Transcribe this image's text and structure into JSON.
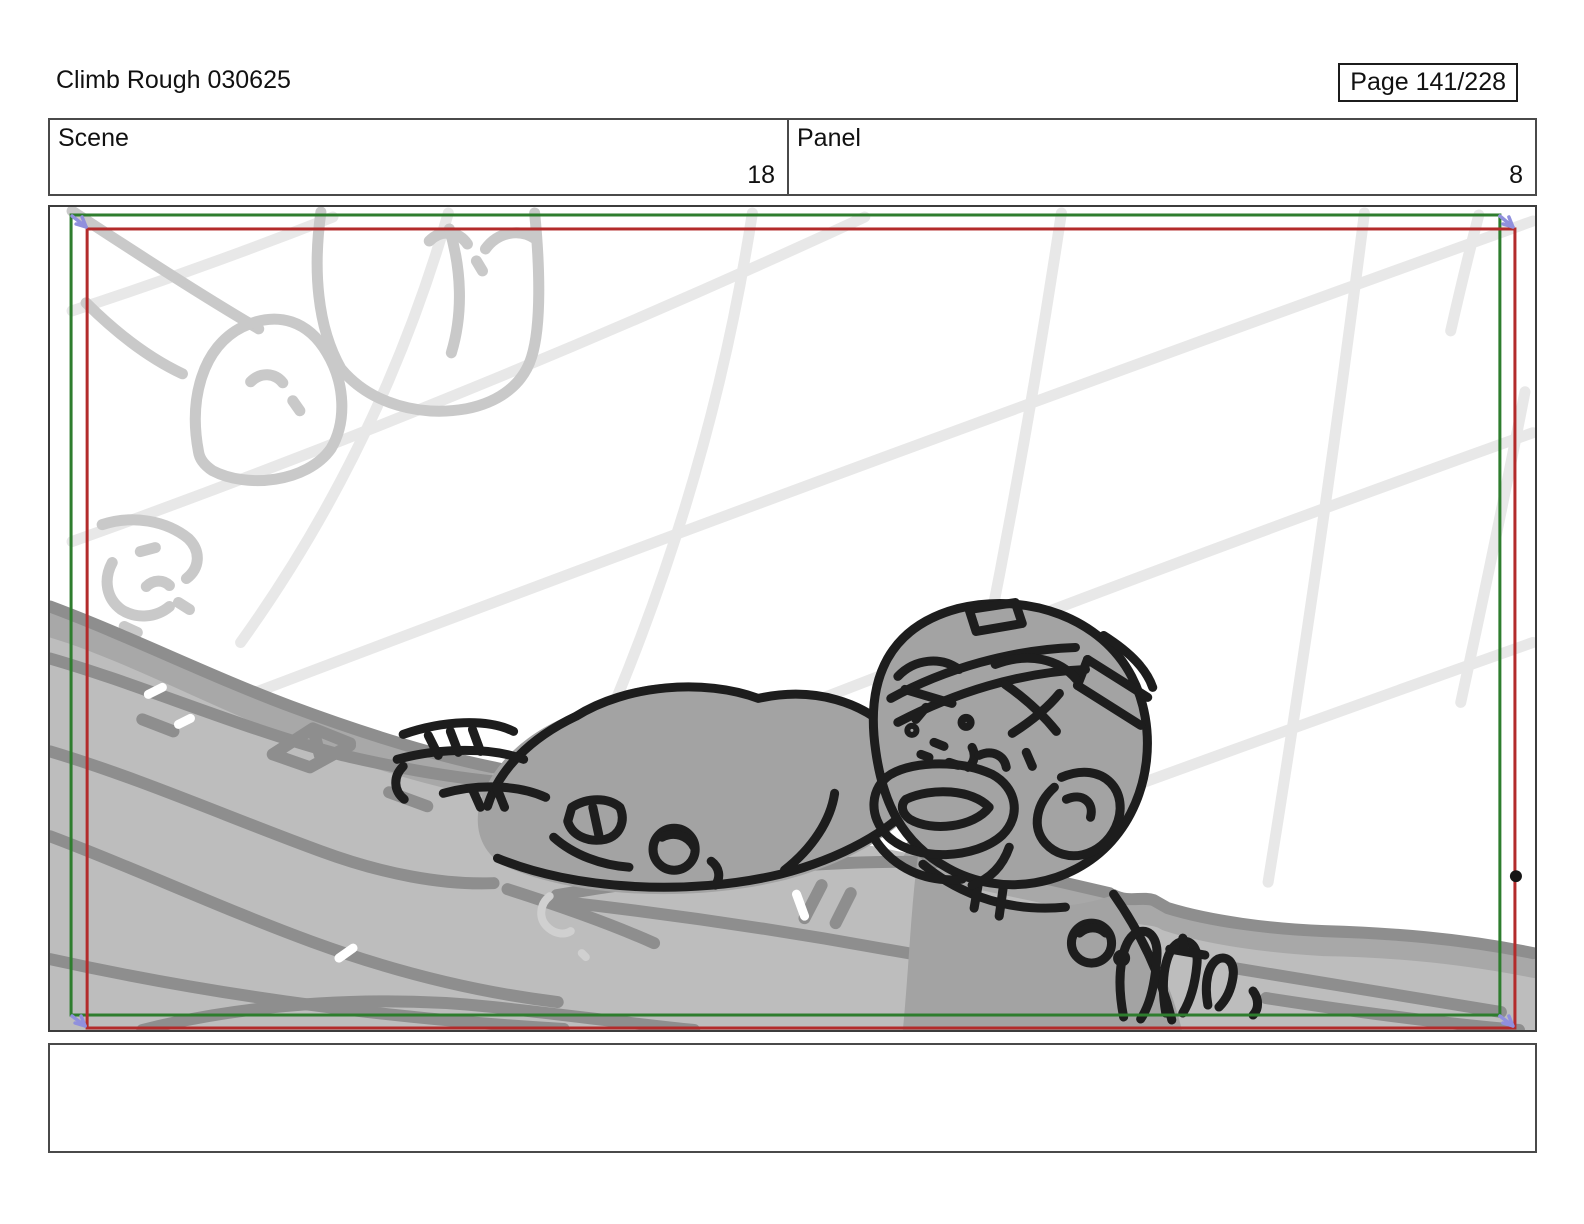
{
  "header": {
    "title": "Climb Rough 030625",
    "page_label": "Page 141/228"
  },
  "info": {
    "scene_label": "Scene",
    "scene_value": "18",
    "panel_label": "Panel",
    "panel_value": "8"
  },
  "caption": {
    "text": ""
  },
  "colors": {
    "frame-green": "#2e7d2e",
    "frame-red": "#b32b2b",
    "camera-arrow": "#9090dd",
    "grid-line": "#e8e8e8",
    "boulder-line": "#c9c9c9",
    "slope-fill": "#bdbdbd",
    "slope-dark": "#a8a8a8",
    "slope-stroke": "#8e8e8e",
    "figure-fill": "#a3a3a3",
    "figure-line": "#1d1d1d"
  }
}
